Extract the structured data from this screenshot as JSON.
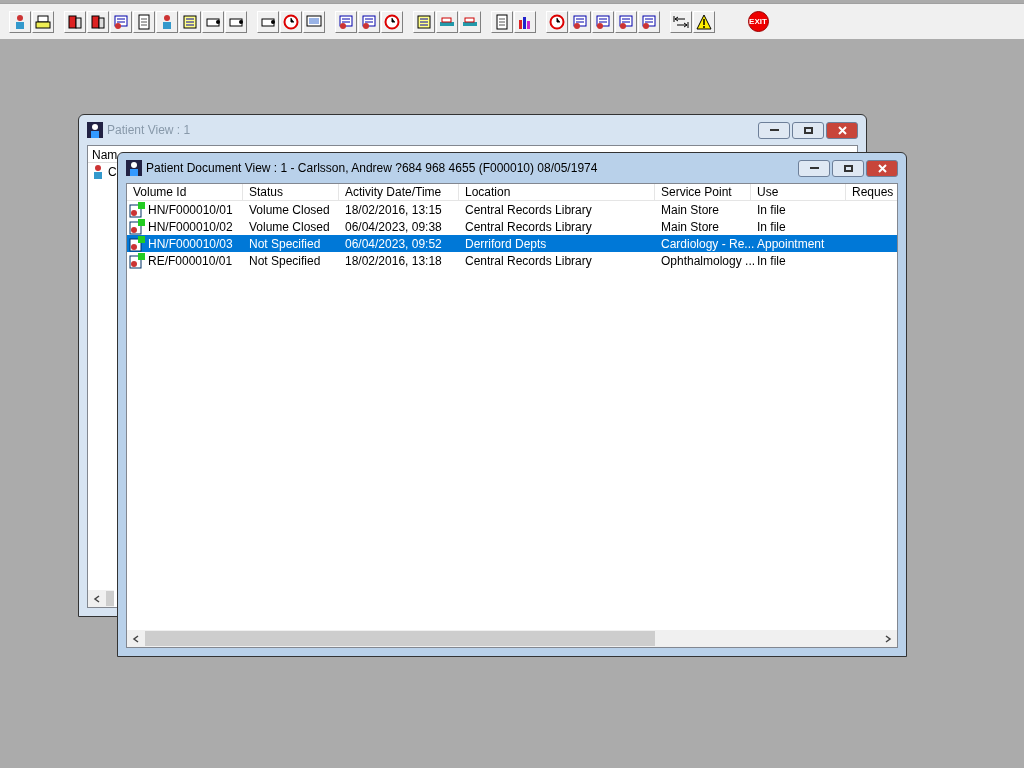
{
  "exit_label": "EXIT",
  "back_window": {
    "title": "Patient View : 1",
    "column_1": "Nam",
    "row_1": "C"
  },
  "front_window": {
    "title": "Patient Document View : 1 - Carlsson, Andrew ?684 968 4655 (F000010) 08/05/1974",
    "table": {
      "columns": [
        "Volume Id",
        "Status",
        "Activity Date/Time",
        "Location",
        "Service Point",
        "Use",
        "Reques"
      ],
      "rows": [
        {
          "cells": [
            "HN/F000010/01",
            "Volume Closed",
            "18/02/2016, 13:15",
            "Central Records Library",
            "Main Store",
            "In file"
          ],
          "selected": false
        },
        {
          "cells": [
            "HN/F000010/02",
            "Volume Closed",
            "06/04/2023, 09:38",
            "Central Records Library",
            "Main Store",
            "In file"
          ],
          "selected": false
        },
        {
          "cells": [
            "HN/F000010/03",
            "Not Specified",
            "06/04/2023, 09:52",
            "Derriford Depts",
            "Cardiology - Re...",
            "Appointment"
          ],
          "selected": true
        },
        {
          "cells": [
            "RE/F000010/01",
            "Not Specified",
            "18/02/2016, 13:18",
            "Central Records Library",
            "Ophthalmology ...",
            "In file"
          ],
          "selected": false
        }
      ]
    }
  }
}
